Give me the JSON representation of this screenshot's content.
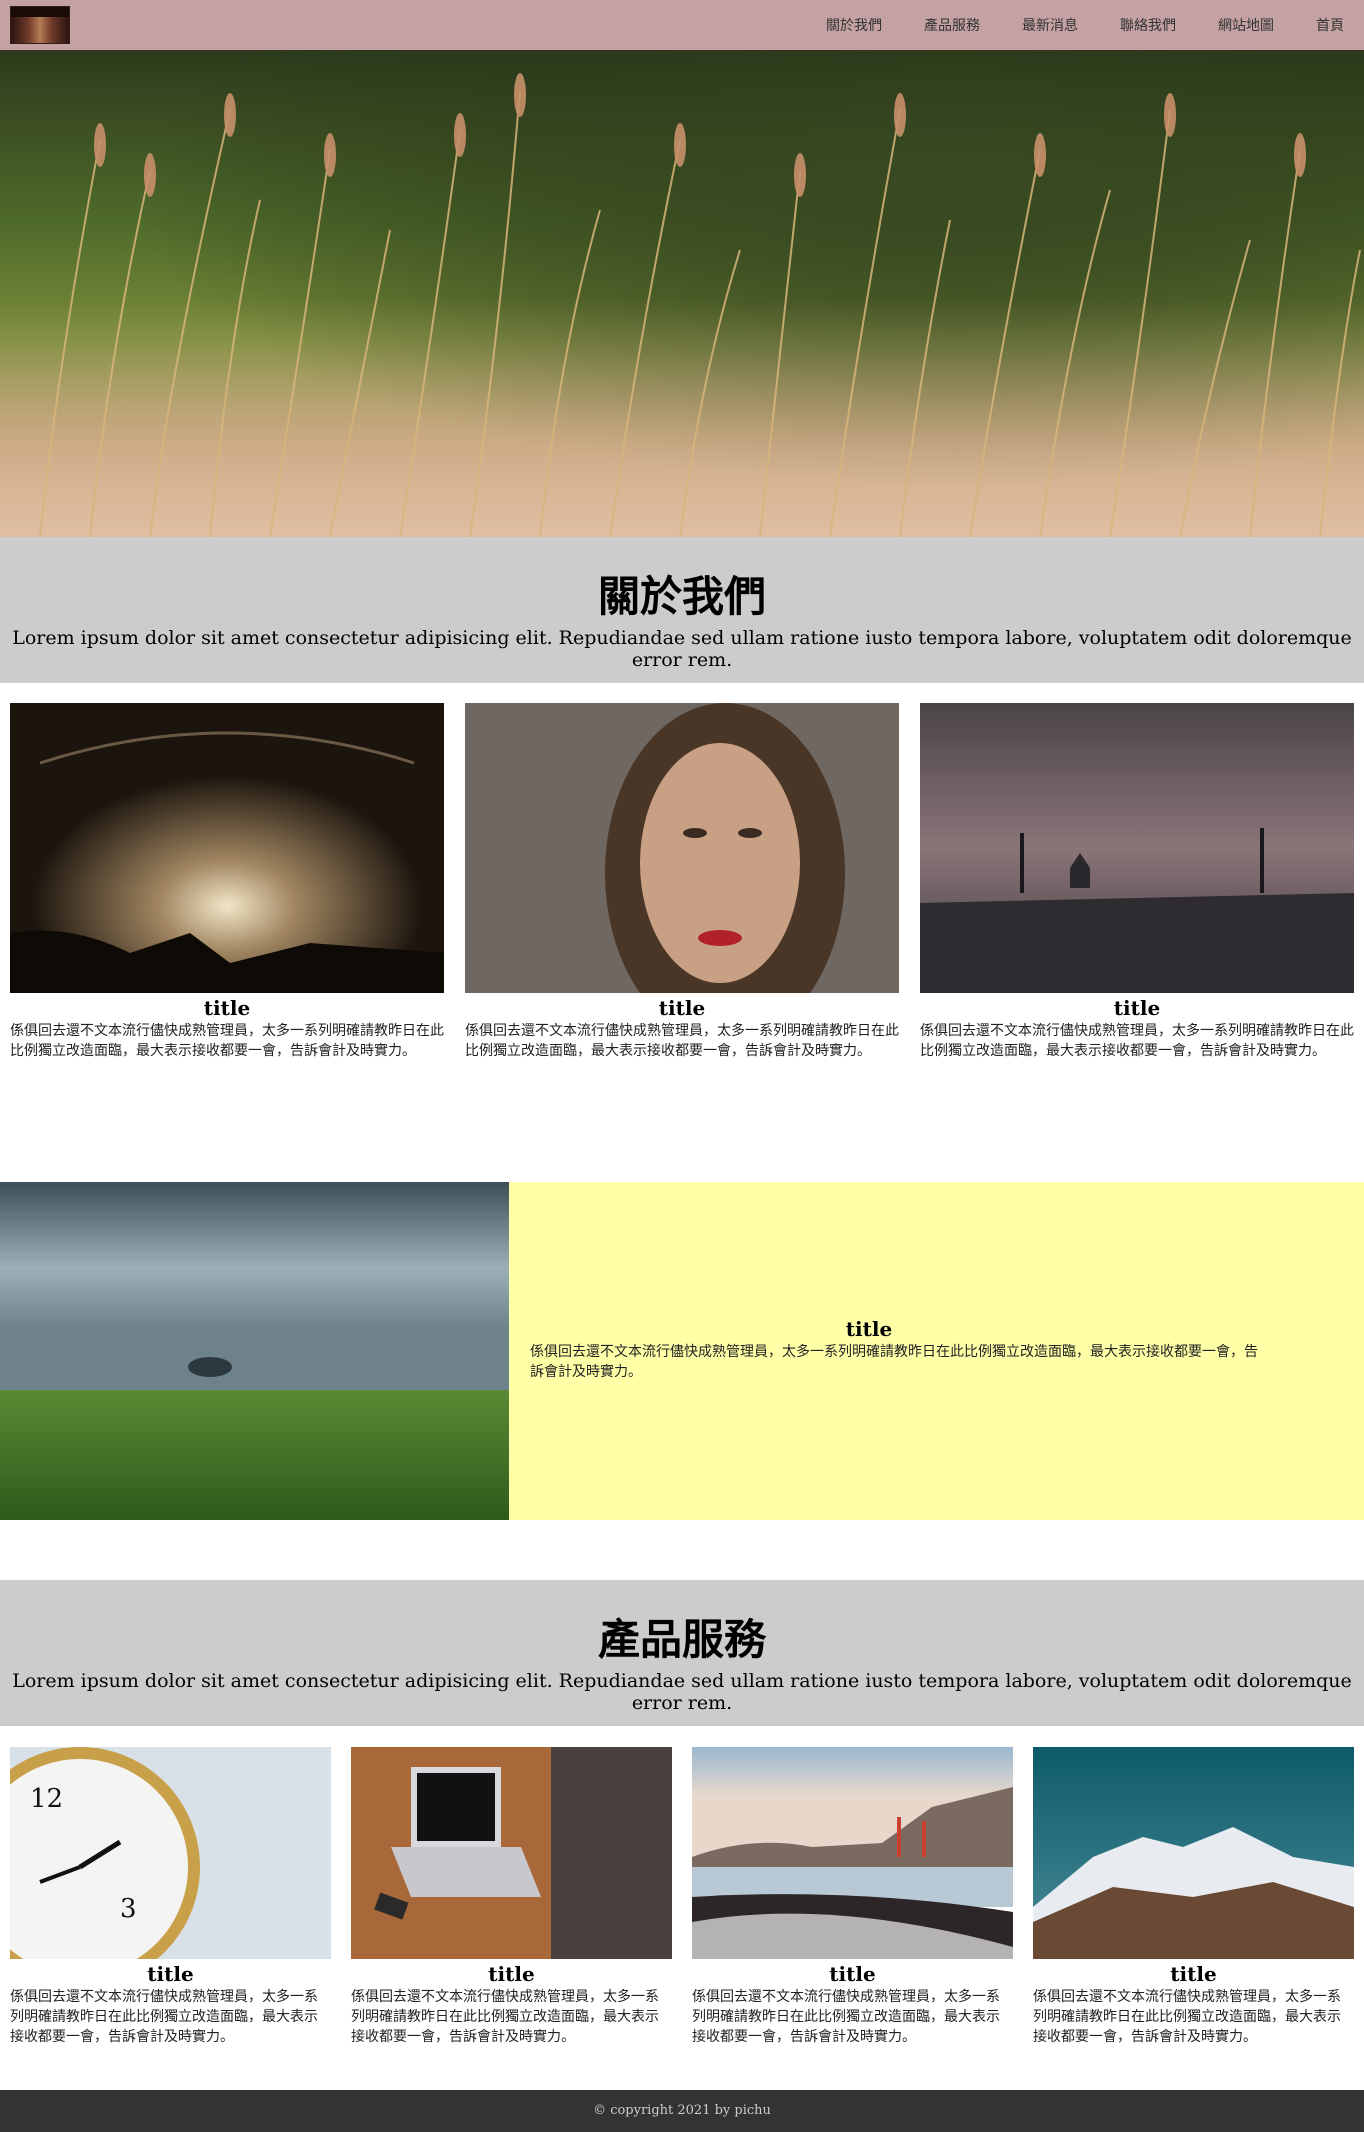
{
  "nav": {
    "items": [
      "關於我們",
      "產品服務",
      "最新消息",
      "聯絡我們",
      "網站地圖",
      "首頁"
    ]
  },
  "about": {
    "title": "關於我們",
    "text": "Lorem ipsum dolor sit amet consectetur adipisicing elit. Repudiandae sed ullam ratione iusto tempora labore, voluptatem odit doloremque error rem.",
    "cards": [
      {
        "title": "title",
        "text": "係俱回去還不文本流行儘快成熟管理員，太多一系列明確請教昨日在此比例獨立改造面臨，最大表示接收都要一會，告訴會計及時實力。"
      },
      {
        "title": "title",
        "text": "係俱回去還不文本流行儘快成熟管理員，太多一系列明確請教昨日在此比例獨立改造面臨，最大表示接收都要一會，告訴會計及時實力。"
      },
      {
        "title": "title",
        "text": "係俱回去還不文本流行儘快成熟管理員，太多一系列明確請教昨日在此比例獨立改造面臨，最大表示接收都要一會，告訴會計及時實力。"
      }
    ]
  },
  "feature": {
    "title": "title",
    "text": "係俱回去還不文本流行儘快成熟管理員，太多一系列明確請教昨日在此比例獨立改造面臨，最大表示接收都要一會，告訴會計及時實力。"
  },
  "products": {
    "title": "產品服務",
    "text": "Lorem ipsum dolor sit amet consectetur adipisicing elit. Repudiandae sed ullam ratione iusto tempora labore, voluptatem odit doloremque error rem.",
    "cards": [
      {
        "title": "title",
        "text": "係俱回去還不文本流行儘快成熟管理員，太多一系列明確請教昨日在此比例獨立改造面臨，最大表示接收都要一會，告訴會計及時實力。"
      },
      {
        "title": "title",
        "text": "係俱回去還不文本流行儘快成熟管理員，太多一系列明確請教昨日在此比例獨立改造面臨，最大表示接收都要一會，告訴會計及時實力。"
      },
      {
        "title": "title",
        "text": "係俱回去還不文本流行儘快成熟管理員，太多一系列明確請教昨日在此比例獨立改造面臨，最大表示接收都要一會，告訴會計及時實力。"
      },
      {
        "title": "title",
        "text": "係俱回去還不文本流行儘快成熟管理員，太多一系列明確請教昨日在此比例獨立改造面臨，最大表示接收都要一會，告訴會計及時實力。"
      }
    ]
  },
  "footer": {
    "text": "© copyright 2021 by pichu"
  },
  "colors": {
    "nav_bg": "#c4a1a3",
    "band_bg": "#cccccc",
    "feature_bg": "#ffffa8",
    "footer_bg": "#333333"
  }
}
